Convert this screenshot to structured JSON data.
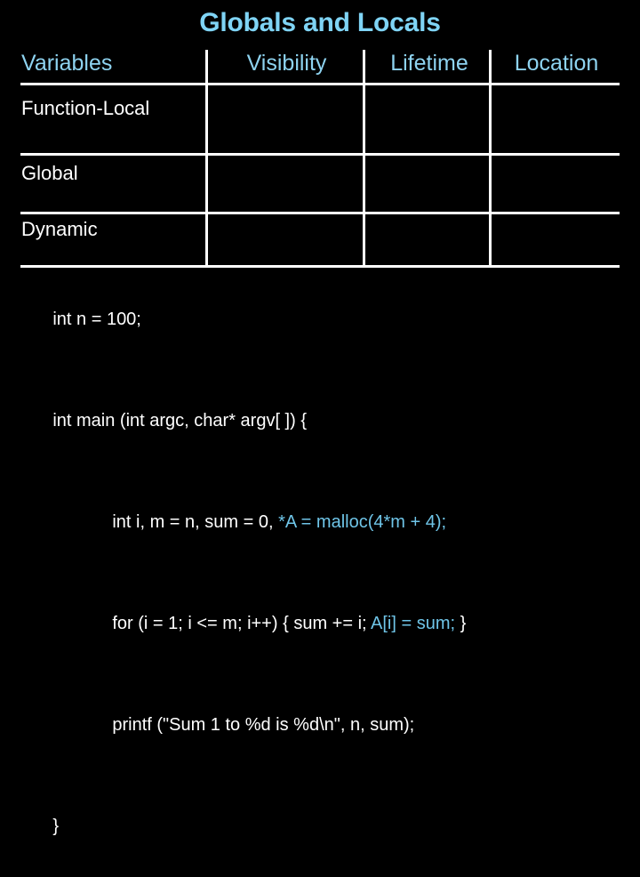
{
  "slide": {
    "title": "Globals and Locals",
    "background_color": "#000000",
    "accent_color": "#7FD4F5",
    "text_color": "#FFFFFF",
    "highlight_color": "#6FC5E8"
  },
  "table": {
    "columns": [
      {
        "label": "Variables"
      },
      {
        "label": "Visibility"
      },
      {
        "label": "Lifetime"
      },
      {
        "label": "Location"
      }
    ],
    "rows": [
      {
        "label": "Function-Local",
        "visibility": "",
        "lifetime": "",
        "location": ""
      },
      {
        "label": "Global",
        "visibility": "",
        "lifetime": "",
        "location": ""
      },
      {
        "label": "Dynamic",
        "visibility": "",
        "lifetime": "",
        "location": ""
      }
    ]
  },
  "code": {
    "lines": [
      {
        "indent": false,
        "plain": "int n = 100;",
        "highlight": "",
        "tail": ""
      },
      {
        "indent": false,
        "plain": "int main (int argc, char* argv[ ]) {",
        "highlight": "",
        "tail": ""
      },
      {
        "indent": true,
        "plain": "int i, m = n, sum = 0, ",
        "highlight": "*A = malloc(4*m + 4);",
        "tail": ""
      },
      {
        "indent": true,
        "plain": "for (i = 1; i <= m; i++) { sum += i; ",
        "highlight": "A[i] = sum;",
        "tail": " }"
      },
      {
        "indent": true,
        "plain": "printf (\"Sum 1 to %d is %d\\n\", n, sum);",
        "highlight": "",
        "tail": ""
      },
      {
        "indent": false,
        "plain": "}",
        "highlight": "",
        "tail": ""
      }
    ]
  }
}
